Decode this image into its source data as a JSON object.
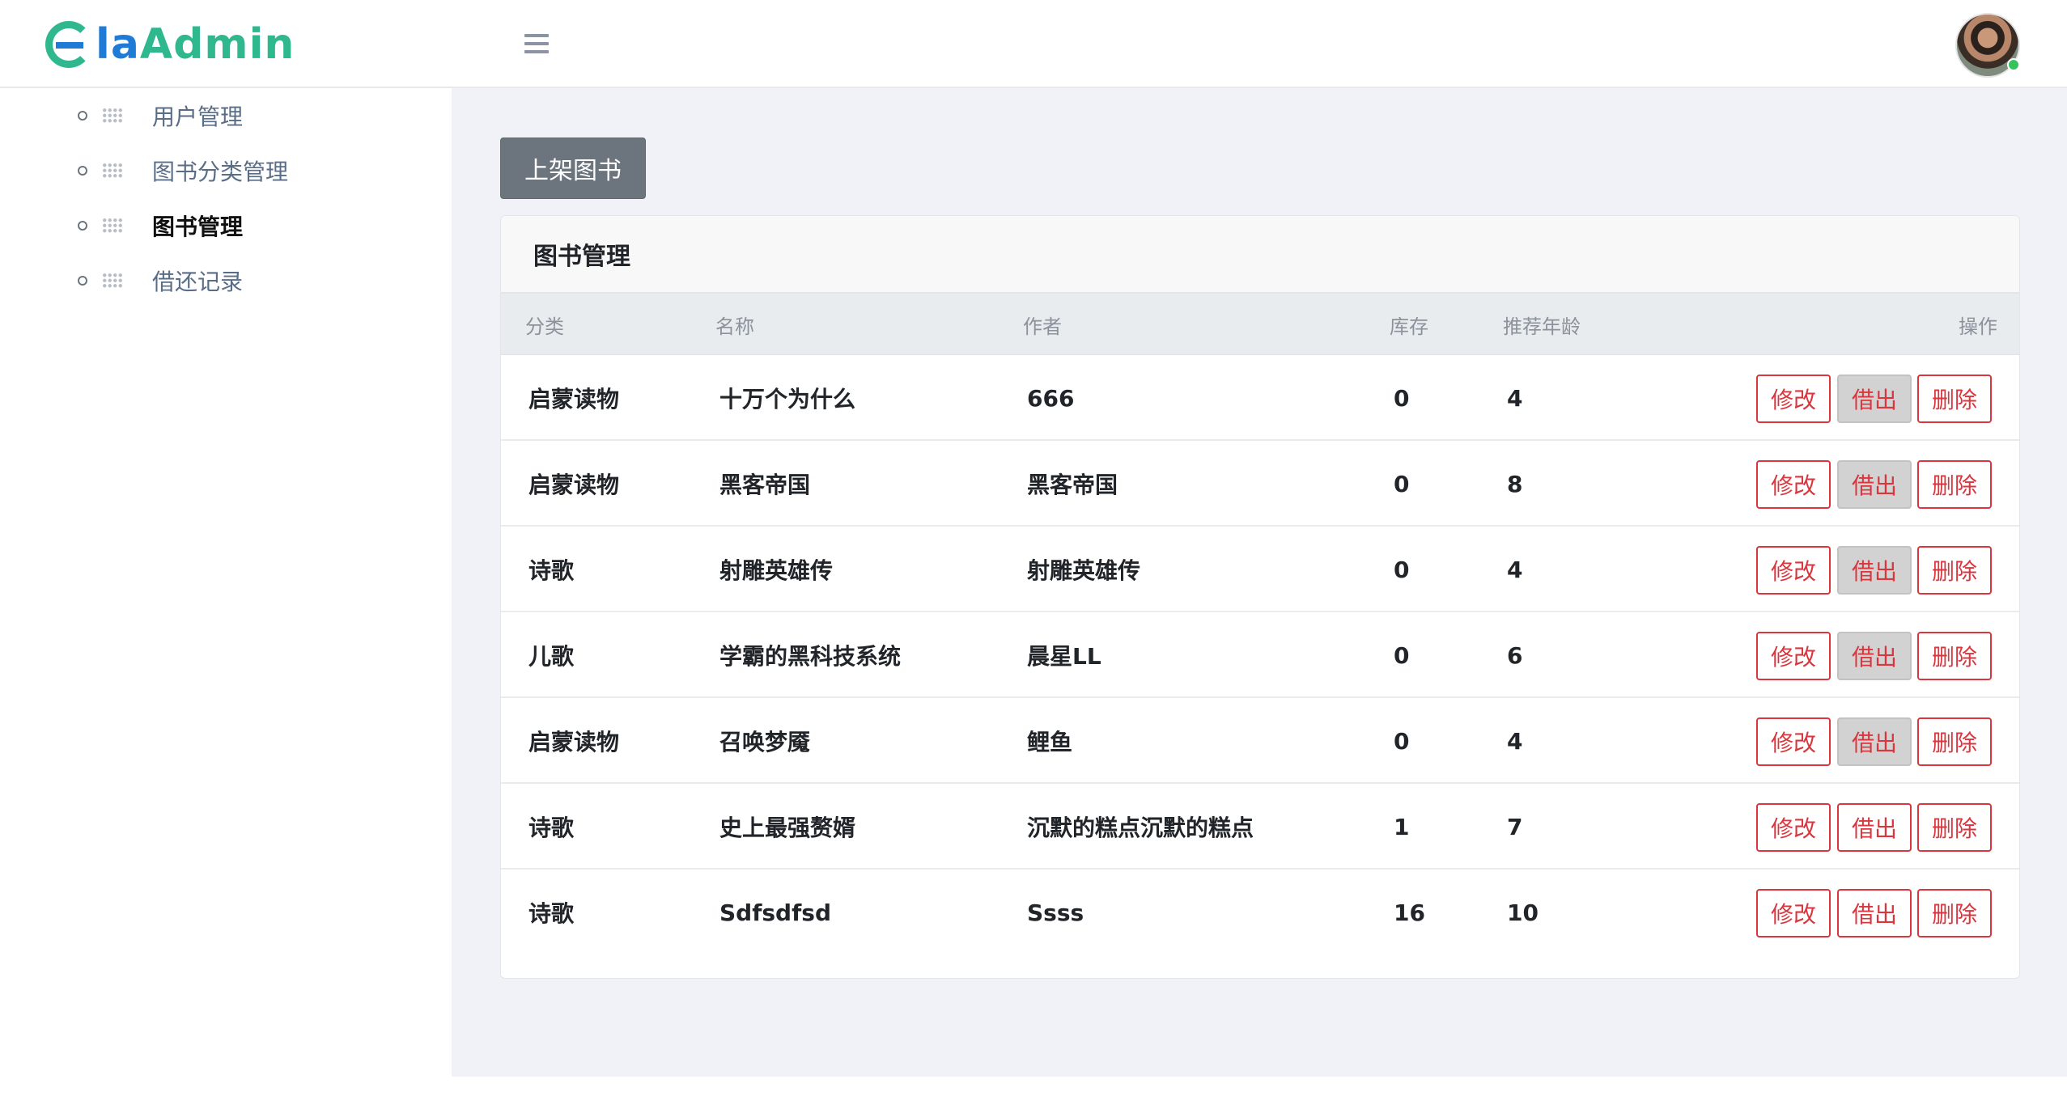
{
  "header": {
    "logo_e": "e",
    "logo_la": "la",
    "logo_admin": "Admin"
  },
  "sidebar": {
    "items": [
      {
        "label": "用户管理"
      },
      {
        "label": "图书分类管理"
      },
      {
        "label": "图书管理"
      },
      {
        "label": "借还记录"
      }
    ]
  },
  "main": {
    "add_button_label": "上架图书",
    "card_title": "图书管理",
    "columns": [
      "分类",
      "名称",
      "作者",
      "库存",
      "推荐年龄",
      "操作"
    ],
    "rows": [
      {
        "category": "启蒙读物",
        "name": "十万个为什么",
        "author": "666",
        "stock": "0",
        "age": "4",
        "edit": "修改",
        "borrow": "借出",
        "delete": "删除"
      },
      {
        "category": "启蒙读物",
        "name": "黑客帝国",
        "author": "黑客帝国",
        "stock": "0",
        "age": "8",
        "edit": "修改",
        "borrow": "借出",
        "delete": "删除"
      },
      {
        "category": "诗歌",
        "name": "射雕英雄传",
        "author": "射雕英雄传",
        "stock": "0",
        "age": "4",
        "edit": "修改",
        "borrow": "借出",
        "delete": "删除"
      },
      {
        "category": "儿歌",
        "name": "学霸的黑科技系统",
        "author": "晨星LL",
        "stock": "0",
        "age": "6",
        "edit": "修改",
        "borrow": "借出",
        "delete": "删除"
      },
      {
        "category": "启蒙读物",
        "name": "召唤梦魇",
        "author": "鲤鱼",
        "stock": "0",
        "age": "4",
        "edit": "修改",
        "borrow": "借出",
        "delete": "删除"
      },
      {
        "category": "诗歌",
        "name": "史上最强赘婿",
        "author": "沉默的糕点沉默的糕点",
        "stock": "1",
        "age": "7",
        "edit": "修改",
        "borrow": "借出",
        "delete": "删除"
      },
      {
        "category": "诗歌",
        "name": "Sdfsdfsd",
        "author": "Ssss",
        "stock": "16",
        "age": "10",
        "edit": "修改",
        "borrow": "借出",
        "delete": "删除"
      }
    ]
  },
  "colors": {
    "brand_green": "#2fb88e",
    "brand_blue": "#1f7bd6",
    "danger": "#d9363e",
    "secondary": "#6c757d",
    "page_bg": "#f1f2f7"
  },
  "icons": [
    "menu-icon",
    "grid-icon",
    "avatar-icon"
  ]
}
